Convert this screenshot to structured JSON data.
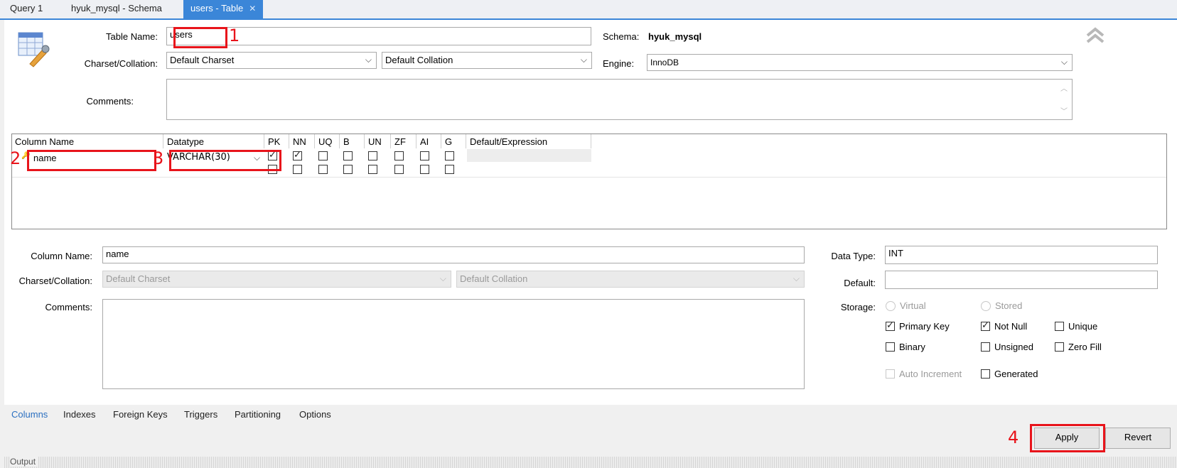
{
  "tabs": [
    {
      "label": "Query 1"
    },
    {
      "label": "hyuk_mysql - Schema"
    },
    {
      "label": "users - Table",
      "active": true
    }
  ],
  "table": {
    "name_label": "Table Name:",
    "name_value": "users",
    "schema_label": "Schema:",
    "schema_value": "hyuk_mysql",
    "charset_label": "Charset/Collation:",
    "charset_value": "Default Charset",
    "collation_value": "Default Collation",
    "engine_label": "Engine:",
    "engine_value": "InnoDB",
    "comments_label": "Comments:"
  },
  "grid": {
    "headers": [
      "Column Name",
      "Datatype",
      "PK",
      "NN",
      "UQ",
      "B",
      "UN",
      "ZF",
      "AI",
      "G",
      "Default/Expression"
    ],
    "rows": [
      {
        "name": "name",
        "datatype": "VARCHAR(30)",
        "flags": {
          "PK": true,
          "NN": true,
          "UQ": false,
          "B": false,
          "UN": false,
          "ZF": false,
          "AI": false,
          "G": false
        }
      },
      {
        "name": "",
        "datatype": "",
        "flags": {
          "PK": false,
          "NN": false,
          "UQ": false,
          "B": false,
          "UN": false,
          "ZF": false,
          "AI": false,
          "G": false
        }
      }
    ]
  },
  "detail": {
    "column_name_label": "Column Name:",
    "column_name_value": "name",
    "charset_label": "Charset/Collation:",
    "charset_value": "Default Charset",
    "collation_value": "Default Collation",
    "comments_label": "Comments:",
    "datatype_label": "Data Type:",
    "datatype_value": "INT",
    "default_label": "Default:",
    "default_value": "",
    "storage_label": "Storage:",
    "virtual_label": "Virtual",
    "stored_label": "Stored",
    "primary_key_label": "Primary Key",
    "not_null_label": "Not Null",
    "unique_label": "Unique",
    "binary_label": "Binary",
    "unsigned_label": "Unsigned",
    "zero_fill_label": "Zero Fill",
    "auto_increment_label": "Auto Increment",
    "generated_label": "Generated",
    "primary_key_checked": true,
    "not_null_checked": true
  },
  "bottom_tabs": [
    "Columns",
    "Indexes",
    "Foreign Keys",
    "Triggers",
    "Partitioning",
    "Options"
  ],
  "buttons": {
    "apply": "Apply",
    "revert": "Revert"
  },
  "output_label": "Output",
  "annotations": [
    "1",
    "2",
    "3",
    "4"
  ],
  "colors": {
    "accent": "#3b86d8",
    "annotation": "#e8141b"
  }
}
